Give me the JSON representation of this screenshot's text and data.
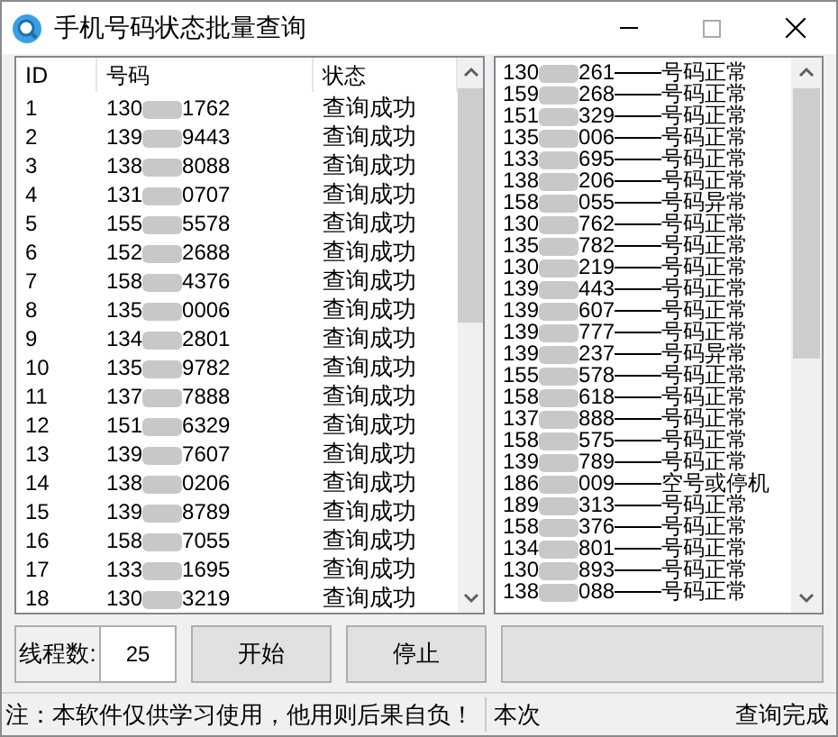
{
  "window": {
    "title": "手机号码状态批量查询"
  },
  "table": {
    "columns": [
      "ID",
      "号码",
      "状态"
    ],
    "rows": [
      {
        "id": "1",
        "prefix": "130",
        "suffix": "1762",
        "status": "查询成功"
      },
      {
        "id": "2",
        "prefix": "139",
        "suffix": "9443",
        "status": "查询成功"
      },
      {
        "id": "3",
        "prefix": "138",
        "suffix": "8088",
        "status": "查询成功"
      },
      {
        "id": "4",
        "prefix": "131",
        "suffix": "0707",
        "status": "查询成功"
      },
      {
        "id": "5",
        "prefix": "155",
        "suffix": "5578",
        "status": "查询成功"
      },
      {
        "id": "6",
        "prefix": "152",
        "suffix": "2688",
        "status": "查询成功"
      },
      {
        "id": "7",
        "prefix": "158",
        "suffix": "4376",
        "status": "查询成功"
      },
      {
        "id": "8",
        "prefix": "135",
        "suffix": "0006",
        "status": "查询成功"
      },
      {
        "id": "9",
        "prefix": "134",
        "suffix": "2801",
        "status": "查询成功"
      },
      {
        "id": "10",
        "prefix": "135",
        "suffix": "9782",
        "status": "查询成功"
      },
      {
        "id": "11",
        "prefix": "137",
        "suffix": "7888",
        "status": "查询成功"
      },
      {
        "id": "12",
        "prefix": "151",
        "suffix": "6329",
        "status": "查询成功"
      },
      {
        "id": "13",
        "prefix": "139",
        "suffix": "7607",
        "status": "查询成功"
      },
      {
        "id": "14",
        "prefix": "138",
        "suffix": "0206",
        "status": "查询成功"
      },
      {
        "id": "15",
        "prefix": "139",
        "suffix": "8789",
        "status": "查询成功"
      },
      {
        "id": "16",
        "prefix": "158",
        "suffix": "7055",
        "status": "查询成功"
      },
      {
        "id": "17",
        "prefix": "133",
        "suffix": "1695",
        "status": "查询成功"
      },
      {
        "id": "18",
        "prefix": "130",
        "suffix": "3219",
        "status": "查询成功"
      }
    ]
  },
  "results": [
    {
      "prefix": "130",
      "suffix": "261",
      "status": "号码正常"
    },
    {
      "prefix": "159",
      "suffix": "268",
      "status": "号码正常"
    },
    {
      "prefix": "151",
      "suffix": "329",
      "status": "号码正常"
    },
    {
      "prefix": "135",
      "suffix": "006",
      "status": "号码正常"
    },
    {
      "prefix": "133",
      "suffix": "695",
      "status": "号码正常"
    },
    {
      "prefix": "138",
      "suffix": "206",
      "status": "号码正常"
    },
    {
      "prefix": "158",
      "suffix": "055",
      "status": "号码异常"
    },
    {
      "prefix": "130",
      "suffix": "762",
      "status": "号码正常"
    },
    {
      "prefix": "135",
      "suffix": "782",
      "status": "号码正常"
    },
    {
      "prefix": "130",
      "suffix": "219",
      "status": "号码正常"
    },
    {
      "prefix": "139",
      "suffix": "443",
      "status": "号码正常"
    },
    {
      "prefix": "139",
      "suffix": "607",
      "status": "号码正常"
    },
    {
      "prefix": "139",
      "suffix": "777",
      "status": "号码正常"
    },
    {
      "prefix": "139",
      "suffix": "237",
      "status": "号码异常"
    },
    {
      "prefix": "155",
      "suffix": "578",
      "status": "号码正常"
    },
    {
      "prefix": "158",
      "suffix": "618",
      "status": "号码正常"
    },
    {
      "prefix": "137",
      "suffix": "888",
      "status": "号码正常"
    },
    {
      "prefix": "158",
      "suffix": "575",
      "status": "号码正常"
    },
    {
      "prefix": "139",
      "suffix": "789",
      "status": "号码正常"
    },
    {
      "prefix": "186",
      "suffix": "009",
      "status": "空号或停机"
    },
    {
      "prefix": "189",
      "suffix": "313",
      "status": "号码正常"
    },
    {
      "prefix": "158",
      "suffix": "376",
      "status": "号码正常"
    },
    {
      "prefix": "134",
      "suffix": "801",
      "status": "号码正常"
    },
    {
      "prefix": "130",
      "suffix": "893",
      "status": "号码正常"
    },
    {
      "prefix": "138",
      "suffix": "088",
      "status": "号码正常"
    }
  ],
  "controls": {
    "threads_label": "线程数:",
    "threads_value": "25",
    "buttons": [
      "开始",
      "停止"
    ]
  },
  "status_bar": {
    "notice": "注：本软件仅供学习使用，他用则后果自负！",
    "summary": "本次",
    "state": "查询完成"
  }
}
